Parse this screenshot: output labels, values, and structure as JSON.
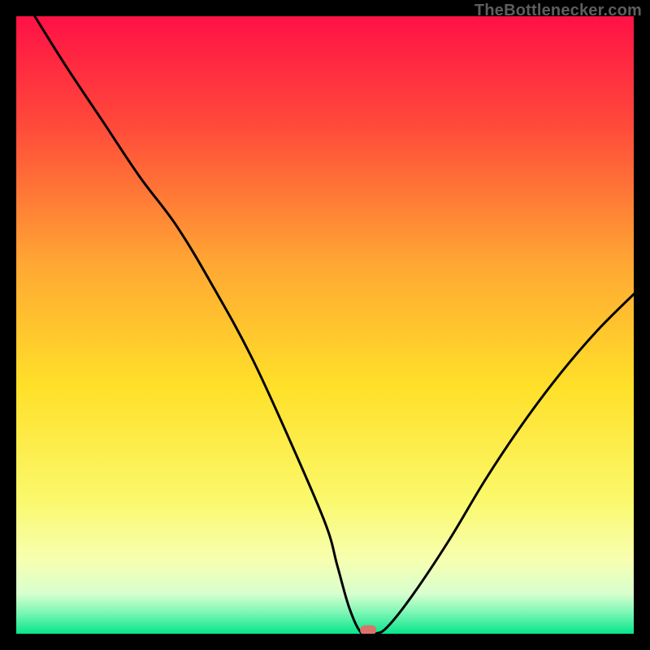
{
  "watermark": "TheBottlenecker.com",
  "chart_data": {
    "type": "line",
    "title": "",
    "xlabel": "",
    "ylabel": "",
    "xlim": [
      0,
      100
    ],
    "ylim": [
      0,
      100
    ],
    "background": "gradient",
    "series": [
      {
        "name": "bottleneck-curve",
        "x": [
          3,
          8,
          14,
          20,
          26,
          32,
          38,
          44,
          50,
          52,
          54,
          56,
          58,
          60,
          64,
          70,
          76,
          82,
          88,
          94,
          100
        ],
        "y": [
          100,
          92,
          83,
          74,
          66,
          56,
          45,
          32,
          18,
          11,
          4,
          0,
          0,
          1,
          6,
          15,
          25,
          34,
          42,
          49,
          55
        ]
      }
    ],
    "marker": {
      "x": 57,
      "y": 0.6,
      "color": "#d9746c"
    },
    "gradient_stops": [
      {
        "offset": 0.0,
        "color": "#ff1146"
      },
      {
        "offset": 0.18,
        "color": "#ff4b3a"
      },
      {
        "offset": 0.4,
        "color": "#ffa733"
      },
      {
        "offset": 0.6,
        "color": "#ffe029"
      },
      {
        "offset": 0.78,
        "color": "#fbf86a"
      },
      {
        "offset": 0.88,
        "color": "#f7ffb0"
      },
      {
        "offset": 0.935,
        "color": "#d8ffce"
      },
      {
        "offset": 0.965,
        "color": "#7ef7b6"
      },
      {
        "offset": 1.0,
        "color": "#07e58b"
      }
    ]
  }
}
